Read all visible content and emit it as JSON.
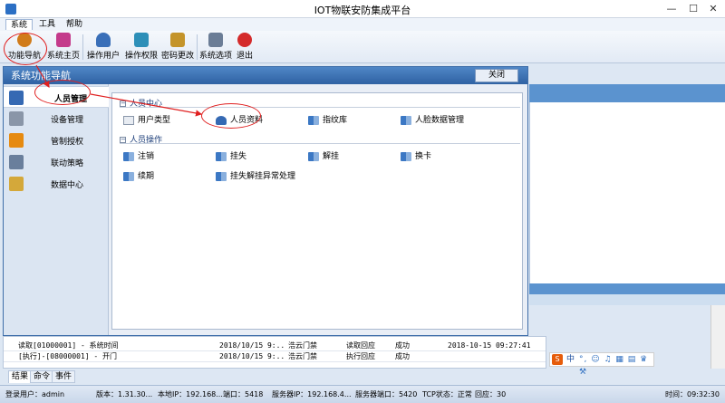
{
  "window": {
    "title": "IOT物联安防集成平台",
    "minimize": "—",
    "maximize": "☐",
    "close": "✕"
  },
  "menu": {
    "items": [
      "系统",
      "工具",
      "帮助"
    ]
  },
  "toolbar": {
    "items": [
      {
        "label": "功能导航",
        "icon": "gear-icon",
        "color": "#d07b1a"
      },
      {
        "label": "系统主页",
        "icon": "home-flower-icon",
        "color": "#c43b8b"
      },
      {
        "label": "操作用户",
        "icon": "user-icon",
        "color": "#3a6fb8"
      },
      {
        "label": "操作权限",
        "icon": "permission-icon",
        "color": "#2d8fb8"
      },
      {
        "label": "密码更改",
        "icon": "password-icon",
        "color": "#c4942a"
      },
      {
        "label": "系统选项",
        "icon": "options-icon",
        "color": "#6b7d96"
      },
      {
        "label": "退出",
        "icon": "exit-icon",
        "color": "#d42a2a"
      }
    ]
  },
  "dialog": {
    "title": "系统功能导航",
    "close_label": "关闭",
    "nav": [
      {
        "label": "人员管理",
        "icon": "people-icon",
        "color": "#3569b3",
        "selected": true
      },
      {
        "label": "设备管理",
        "icon": "device-icon",
        "color": "#8a96a8",
        "selected": false
      },
      {
        "label": "管制授权",
        "icon": "lock-icon",
        "color": "#e68a10",
        "selected": false
      },
      {
        "label": "联动策略",
        "icon": "linkage-icon",
        "color": "#6a7f9c",
        "selected": false
      },
      {
        "label": "数据中心",
        "icon": "data-folder-icon",
        "color": "#d4a83a",
        "selected": false
      }
    ],
    "sections": [
      {
        "title": "人员中心",
        "entries": [
          "用户类型",
          "人员资料",
          "指纹库",
          "人脸数据管理"
        ]
      },
      {
        "title": "人员操作",
        "entries": [
          "注销",
          "挂失",
          "解挂",
          "换卡",
          "续期",
          "挂失解挂异常处理"
        ]
      }
    ]
  },
  "log": {
    "rows": [
      {
        "cmd": "读取[01000001] - 系统时间",
        "time": "2018/10/15 9:...",
        "device": "浩云门禁",
        "reply": "读取回应",
        "result": "成功",
        "value": "2018-10-15 09:27:41"
      },
      {
        "cmd": "[执行]-[08000001] - 开门",
        "time": "2018/10/15 9:...",
        "device": "浩云门禁",
        "reply": "执行回应",
        "result": "成功",
        "value": ""
      }
    ]
  },
  "ime": {
    "logo": "S",
    "lang": "中",
    "tools": "°, ☺ ♫ ▦ ▤ ♛ ⚒"
  },
  "tabs": [
    "结果",
    "命令",
    "事件"
  ],
  "status": {
    "user": "登录用户：admin",
    "version": "版本：1.31.30...",
    "local_ip": "本地IP：192.168...",
    "port": "端口：5418",
    "server_ip": "服务器IP：192.168.4...",
    "server_port": "服务器端口：5420",
    "tcp": "TCP状态：正常",
    "reply": "回应：30",
    "time": "时间：09:32:30"
  }
}
